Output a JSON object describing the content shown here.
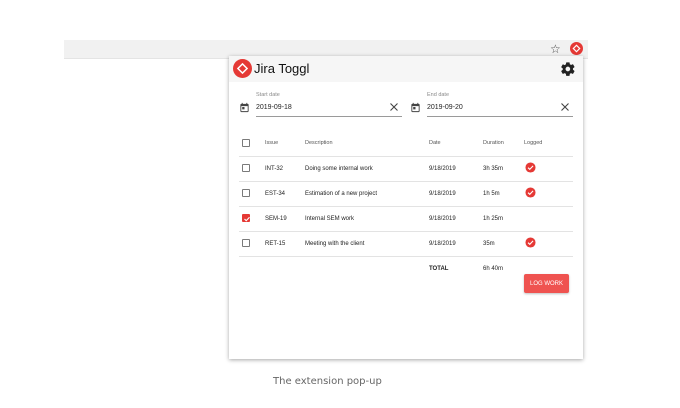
{
  "browser": {
    "star_icon": "star-icon",
    "extension_icon": "jira-toggl-logo"
  },
  "popup": {
    "title": "Jira Toggl",
    "settings_icon": "gear-icon",
    "start_date": {
      "label": "Start date",
      "value": "2019-09-18"
    },
    "end_date": {
      "label": "End date",
      "value": "2019-09-20"
    },
    "table": {
      "headers": {
        "issue": "Issue",
        "description": "Description",
        "date": "Date",
        "duration": "Duration",
        "logged": "Logged"
      },
      "rows": [
        {
          "issue": "INT-32",
          "description": "Doing some internal work",
          "date": "9/18/2019",
          "duration": "3h 35m",
          "logged": true,
          "selected": false
        },
        {
          "issue": "EST-34",
          "description": "Estimation of a new project",
          "date": "9/18/2019",
          "duration": "1h 5m",
          "logged": true,
          "selected": false
        },
        {
          "issue": "SEM-19",
          "description": "Internal SEM work",
          "date": "9/18/2019",
          "duration": "1h 25m",
          "logged": false,
          "selected": true
        },
        {
          "issue": "RET-15",
          "description": "Meeting with the client",
          "date": "9/18/2019",
          "duration": "35m",
          "logged": true,
          "selected": false
        }
      ],
      "total_label": "TOTAL",
      "total_value": "6h 40m"
    },
    "log_button": "LOG WORK"
  },
  "caption": "The extension pop-up",
  "colors": {
    "accent": "#e53935",
    "button": "#ef5350",
    "header_bg": "#f6f6f6"
  }
}
